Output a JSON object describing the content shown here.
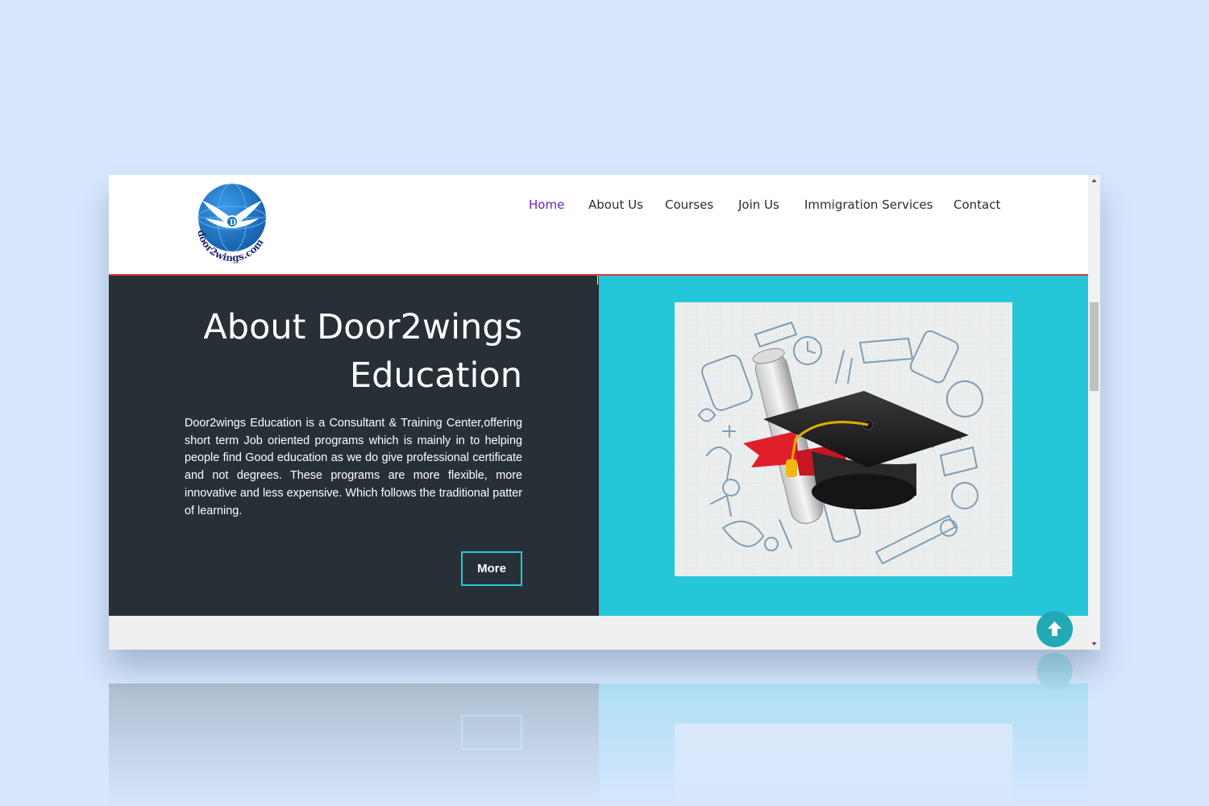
{
  "brand": {
    "logo_text": "door2wings.com"
  },
  "nav": {
    "items": [
      {
        "label": "Home",
        "active": true
      },
      {
        "label": "About Us",
        "active": false
      },
      {
        "label": "Courses",
        "active": false
      },
      {
        "label": "Join Us",
        "active": false
      },
      {
        "label": "Immigration Services",
        "active": false
      },
      {
        "label": "Contact",
        "active": false
      }
    ]
  },
  "about": {
    "title_line1": "About Door2wings",
    "title_line2": "Education",
    "description": "Door2wings Education is a Consultant & Training Center,offering short term Job oriented programs which is mainly in to helping people find Good education as we do give professional certificate and not degrees. These programs are more flexible, more innovative and less expensive. Which follows the traditional patter of learning.",
    "more_label": "More",
    "image": "graduation-cap-and-diploma-illustration"
  },
  "icons": {
    "scroll_to_top": "arrow-up-icon",
    "scroll_up": "triangle-up-icon",
    "scroll_down": "triangle-down-icon"
  },
  "colors": {
    "page_background": "#d6e7fd",
    "nav_active": "#6a1fc4",
    "accent_teal": "#26c6da",
    "dark_panel": "#263036",
    "header_rule": "#e03a3a",
    "logo_blue": "#1e73be"
  }
}
